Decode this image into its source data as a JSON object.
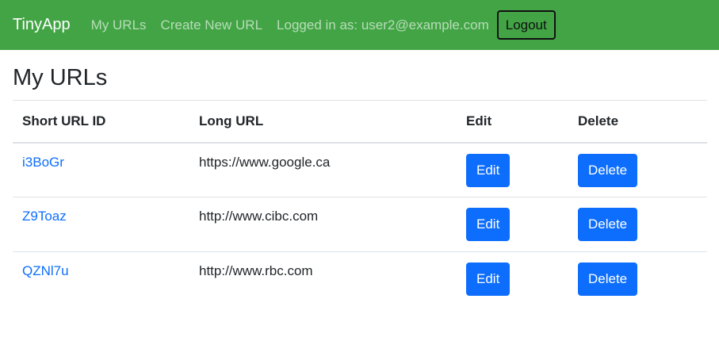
{
  "navbar": {
    "brand": "TinyApp",
    "links": [
      "My URLs",
      "Create New URL"
    ],
    "status": "Logged in as: user2@example.com",
    "logout_label": "Logout"
  },
  "page": {
    "title": "My URLs"
  },
  "table": {
    "headers": [
      "Short URL ID",
      "Long URL",
      "Edit",
      "Delete"
    ],
    "rows": [
      {
        "short_id": "i3BoGr",
        "long_url": "https://www.google.ca",
        "edit_label": "Edit",
        "delete_label": "Delete"
      },
      {
        "short_id": "Z9Toaz",
        "long_url": "http://www.cibc.com",
        "edit_label": "Edit",
        "delete_label": "Delete"
      },
      {
        "short_id": "QZNl7u",
        "long_url": "http://www.rbc.com",
        "edit_label": "Edit",
        "delete_label": "Delete"
      }
    ]
  },
  "colors": {
    "navbar_bg": "#42a445",
    "primary": "#0d6efd",
    "link": "#0d6efd"
  }
}
